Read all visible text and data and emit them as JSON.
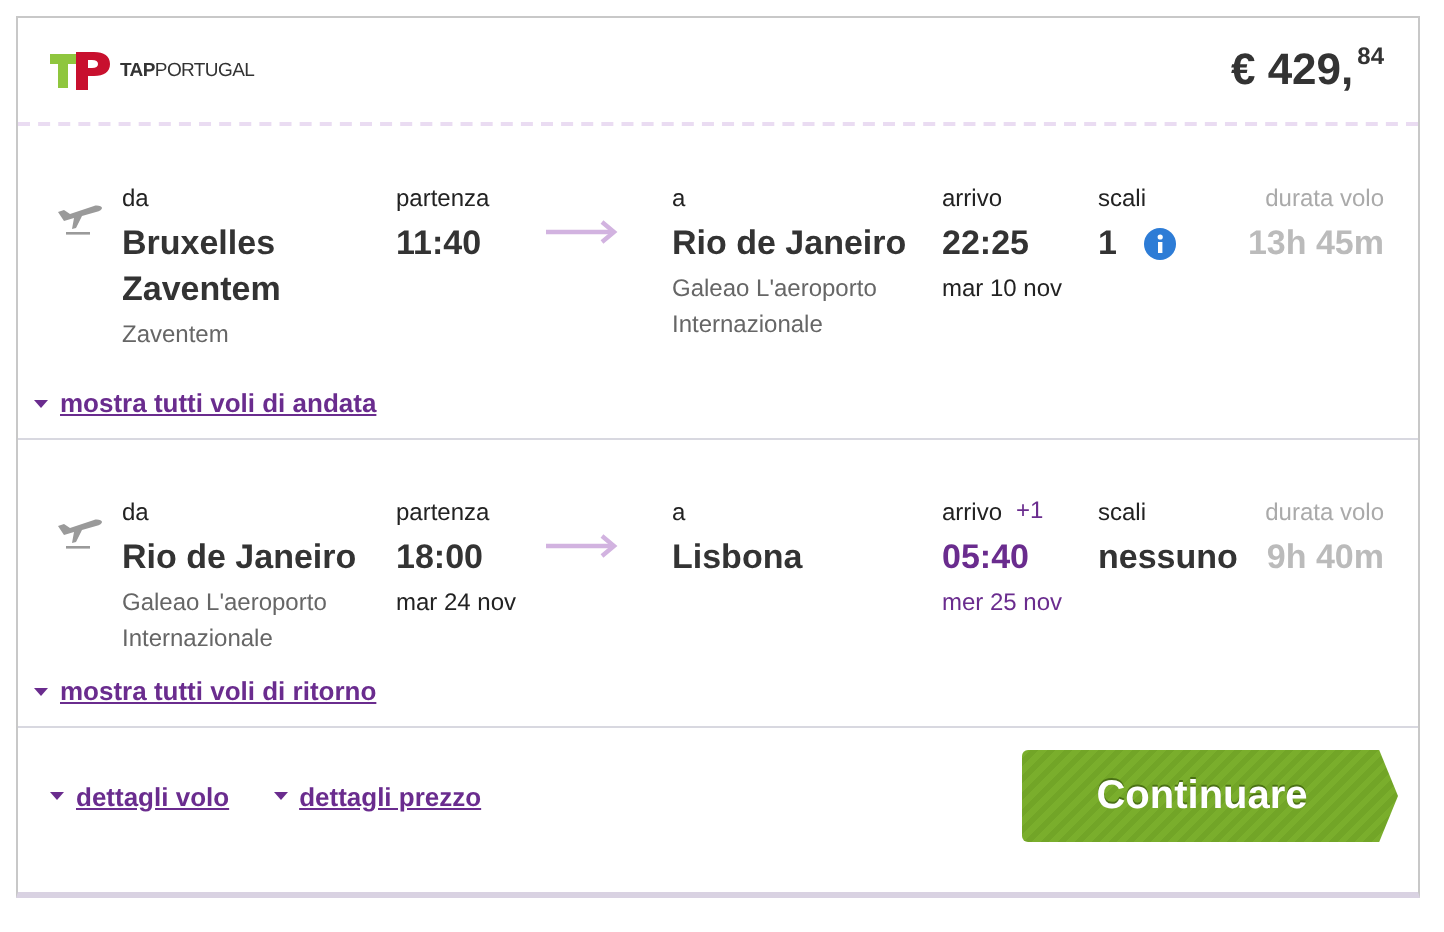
{
  "airline": {
    "logo_text_bold": "TAP",
    "logo_text": "PORTUGAL"
  },
  "price": {
    "main": "€ 429,",
    "cents": "84"
  },
  "legs": [
    {
      "from_label": "da",
      "from_city": "Bruxelles Zaventem",
      "from_airport": "Zaventem",
      "departure_label": "partenza",
      "departure_time": "11:40",
      "to_label": "a",
      "to_city": "Rio de Janeiro",
      "to_airport": "Galeao L'aeroporto Internazionale",
      "arrival_label": "arrivo",
      "arrival_time": "22:25",
      "arrival_date": "mar 10 nov",
      "next_day": false,
      "stops_label": "scali",
      "stops": "1",
      "stops_info": true,
      "duration_label": "durata volo",
      "duration": "13h 45m",
      "link": "mostra tutti voli di andata"
    },
    {
      "from_label": "da",
      "from_city": "Rio de Janeiro",
      "from_airport": "Galeao L'aeroporto Internazionale",
      "departure_label": "partenza",
      "departure_time": "18:00",
      "departure_date": "mar 24 nov",
      "to_label": "a",
      "to_city": "Lisbona",
      "arrival_label": "arrivo",
      "day_offset": "+1",
      "arrival_time": "05:40",
      "arrival_date": "mer 25 nov",
      "next_day": true,
      "stops_label": "scali",
      "stops": "nessuno",
      "stops_info": false,
      "duration_label": "durata volo",
      "duration": "9h 40m",
      "link": "mostra tutti voli di ritorno"
    }
  ],
  "footer_links": [
    "dettagli volo",
    "dettagli prezzo"
  ],
  "continue_button": "Continuare"
}
